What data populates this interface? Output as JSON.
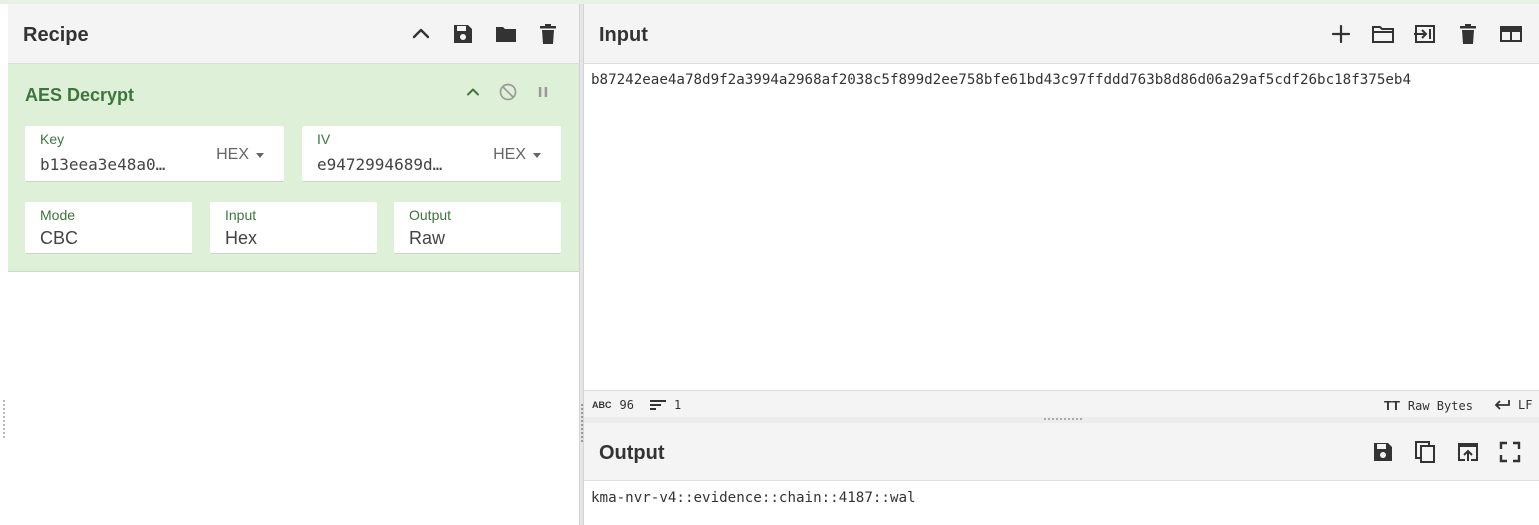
{
  "recipe": {
    "title": "Recipe",
    "operation": {
      "name": "AES Decrypt",
      "key": {
        "label": "Key",
        "value": "b13eea3e48a0…",
        "format": "HEX"
      },
      "iv": {
        "label": "IV",
        "value": "e9472994689d…",
        "format": "HEX"
      },
      "mode": {
        "label": "Mode",
        "value": "CBC"
      },
      "input": {
        "label": "Input",
        "value": "Hex"
      },
      "output": {
        "label": "Output",
        "value": "Raw"
      }
    }
  },
  "input": {
    "title": "Input",
    "text": "b87242eae4a78d9f2a3994a2968af2038c5f899d2ee758bfe61bd43c97ffddd763b8d86d06a29af5cdf26bc18f375eb4",
    "status": {
      "chars_icon": "ABC",
      "chars": "96",
      "lines": "1",
      "encoding_icon": "TT",
      "encoding": "Raw Bytes",
      "eol": "LF"
    }
  },
  "output": {
    "title": "Output",
    "text": "kma-nvr-v4::evidence::chain::4187::wal"
  },
  "icons": {
    "accent": "#3c763d",
    "op_background": "#dff0d8"
  }
}
